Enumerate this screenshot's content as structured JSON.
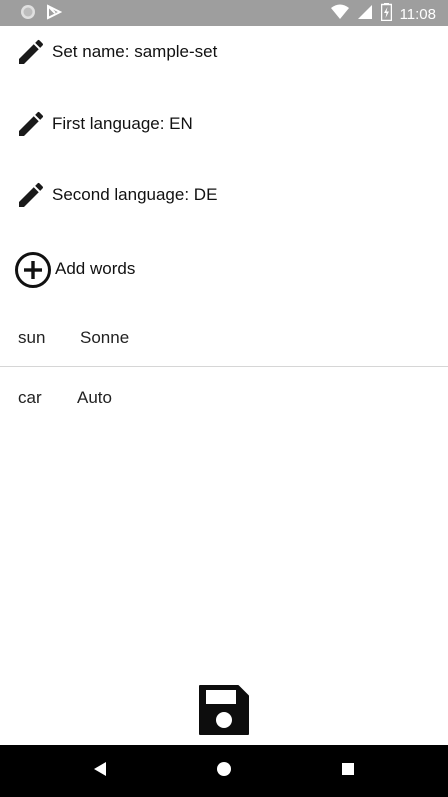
{
  "status_bar": {
    "time": "11:08",
    "icons": [
      "circle-notification-icon",
      "play-store-notification-icon",
      "wifi-icon",
      "cellular-signal-icon",
      "battery-charging-icon"
    ]
  },
  "settings": {
    "set_name": "Set name: sample-set",
    "first_language": "First language: EN",
    "second_language": "Second language: DE",
    "add_words": "Add words"
  },
  "words": [
    {
      "first": "sun",
      "second": "Sonne"
    },
    {
      "first": "car",
      "second": "Auto"
    }
  ],
  "icons": {
    "edit": "pencil-icon",
    "add": "add-circle-icon",
    "save": "floppy-disk-icon"
  },
  "nav_bar": {
    "buttons": [
      "back-icon",
      "home-icon",
      "recents-icon"
    ]
  },
  "colors": {
    "status_bar": "#9e9e9e",
    "nav_bar": "#000000",
    "icon": "#1a1a1a",
    "divider": "#d6d6d6"
  }
}
